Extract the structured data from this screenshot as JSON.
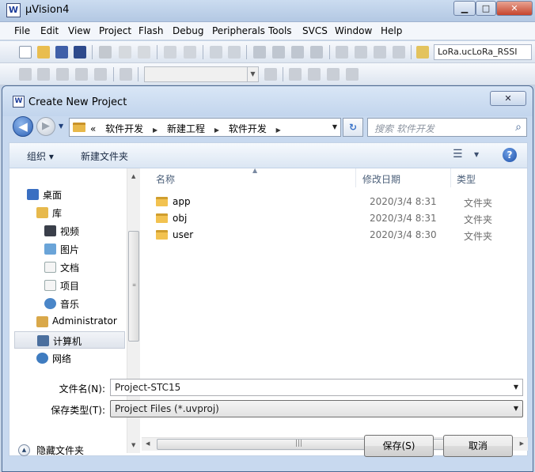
{
  "app": {
    "title": "µVision4",
    "logo": "W",
    "min_glyph": "▁",
    "max_glyph": "□",
    "close_glyph": "✕"
  },
  "menu": [
    "File",
    "Edit",
    "View",
    "Project",
    "Flash",
    "Debug",
    "Peripherals",
    "Tools",
    "SVCS",
    "Window",
    "Help"
  ],
  "toolbar": {
    "target": "LoRa.ucLoRa_RSSI",
    "combo_arrow": "▼"
  },
  "dialog": {
    "title": "Create New Project",
    "close_glyph": "✕",
    "back_glyph": "◀",
    "fwd_glyph": "▶",
    "nav_drop": "▼",
    "breadcrumb": {
      "lead": "«",
      "items": [
        "软件开发",
        "新建工程",
        "软件开发"
      ],
      "sep": "▶",
      "drop": "▼"
    },
    "refresh_glyph": "↻",
    "search_placeholder": "搜索 软件开发",
    "search_glyph": "⌕",
    "organize_label": "组织 ▾",
    "new_folder_label": "新建文件夹",
    "views_glyph": "☰",
    "views_drop": "▼",
    "help_glyph": "?",
    "nav_tree": [
      {
        "label": "桌面"
      },
      {
        "label": "库"
      },
      {
        "label": "视频"
      },
      {
        "label": "图片"
      },
      {
        "label": "文档"
      },
      {
        "label": "项目"
      },
      {
        "label": "音乐"
      },
      {
        "label": "Administrator"
      },
      {
        "label": "计算机"
      },
      {
        "label": "网络"
      }
    ],
    "columns": {
      "name": "名称",
      "date": "修改日期",
      "type": "类型",
      "sort_glyph": "▲"
    },
    "files": [
      {
        "name": "app",
        "date": "2020/3/4 8:31",
        "type": "文件夹"
      },
      {
        "name": "obj",
        "date": "2020/3/4 8:31",
        "type": "文件夹"
      },
      {
        "name": "user",
        "date": "2020/3/4 8:30",
        "type": "文件夹"
      }
    ],
    "scroll": {
      "up": "▲",
      "down": "▼",
      "left": "◀",
      "right": "▶",
      "grip": "|||"
    },
    "filename_label": "文件名(N):",
    "filename_value": "Project-STC15",
    "filetype_label": "保存类型(T):",
    "filetype_value": "Project Files (*.uvproj)",
    "field_arrow": "▼",
    "hide_folders_label": "隐藏文件夹",
    "hide_folders_glyph": "▲",
    "save_label": "保存(S)",
    "cancel_label": "取消"
  },
  "colors": {
    "accent": "#2b5fb4",
    "folder": "#f2c250",
    "chrome": "#c8d9ef"
  }
}
